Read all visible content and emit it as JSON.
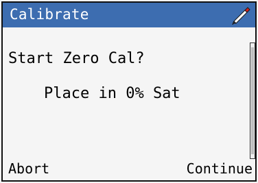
{
  "window": {
    "title": "Calibrate",
    "title_bar_color": "#3d6db0",
    "title_icon": "pencil-icon"
  },
  "dialog": {
    "prompt": "Start Zero Cal?",
    "instruction": "Place in 0% Sat"
  },
  "softkeys": {
    "left_label": "Abort",
    "right_label": "Continue"
  }
}
